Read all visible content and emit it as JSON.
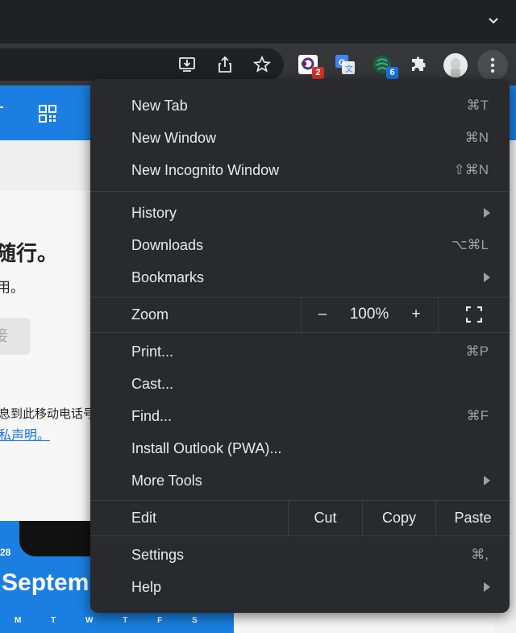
{
  "toolbar": {
    "extensions": [
      {
        "name": "password-extension-icon",
        "badge": "2",
        "badge_color": "#d93025"
      },
      {
        "name": "google-translate-icon",
        "badge": null
      },
      {
        "name": "green-extension-icon",
        "badge": "6",
        "badge_color": "#1a73e8"
      }
    ]
  },
  "page": {
    "heading_fragment": "随行。",
    "subtext_fragment": "用。",
    "button_fragment": "接",
    "info_fragment": "息到此移动电话号",
    "link_fragment": "私声明。",
    "phone_date": "28",
    "phone_title": "Septemb",
    "phone_days": "M T W T F S"
  },
  "menu": {
    "group1": [
      {
        "label": "New Tab",
        "shortcut": "⌘T"
      },
      {
        "label": "New Window",
        "shortcut": "⌘N"
      },
      {
        "label": "New Incognito Window",
        "shortcut": "⇧⌘N"
      }
    ],
    "group2": [
      {
        "label": "History",
        "submenu": true
      },
      {
        "label": "Downloads",
        "shortcut": "⌥⌘L"
      },
      {
        "label": "Bookmarks",
        "submenu": true
      }
    ],
    "zoom": {
      "label": "Zoom",
      "minus": "–",
      "level": "100%",
      "plus": "+"
    },
    "group3": [
      {
        "label": "Print...",
        "shortcut": "⌘P"
      },
      {
        "label": "Cast..."
      },
      {
        "label": "Find...",
        "shortcut": "⌘F"
      },
      {
        "label": "Install Outlook (PWA)..."
      },
      {
        "label": "More Tools",
        "submenu": true
      }
    ],
    "edit": {
      "label": "Edit",
      "cut": "Cut",
      "copy": "Copy",
      "paste": "Paste"
    },
    "group4": [
      {
        "label": "Settings",
        "shortcut": "⌘,"
      },
      {
        "label": "Help",
        "submenu": true
      }
    ]
  }
}
